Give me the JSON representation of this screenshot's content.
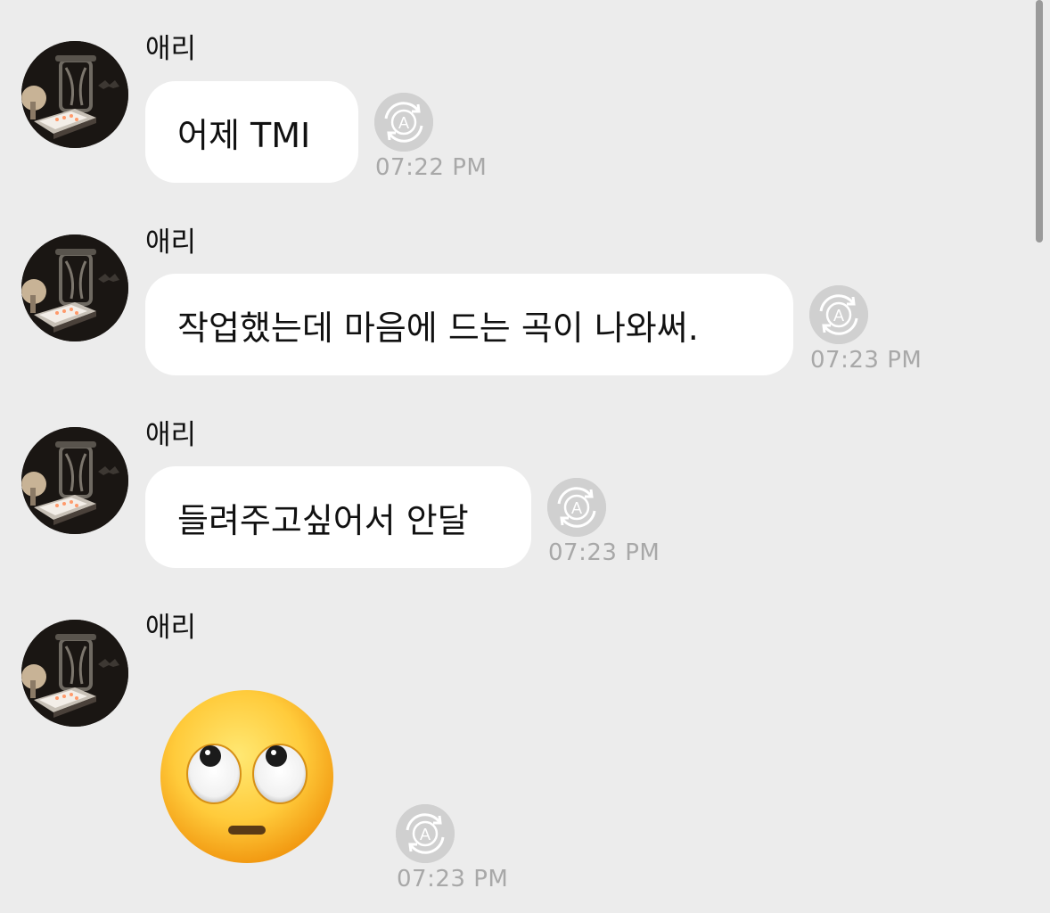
{
  "messages": [
    {
      "sender": "애리",
      "text": "어제 TMI",
      "time": "07:22 PM"
    },
    {
      "sender": "애리",
      "text": "작업했는데 마음에 드는 곡이 나와써.",
      "time": "07:23 PM"
    },
    {
      "sender": "애리",
      "text": "들려주고싶어서 안달",
      "time": "07:23 PM"
    },
    {
      "sender": "애리",
      "emoji": "face-with-rolling-eyes",
      "time": "07:23 PM"
    }
  ],
  "icons": {
    "avatar": "avatar-photo",
    "translate": "translate-icon",
    "translate_glyph": "A"
  },
  "colors": {
    "background": "#ececec",
    "bubble": "#ffffff",
    "timestamp": "#a8a8a8",
    "translate_button": "#d0d0d0"
  }
}
